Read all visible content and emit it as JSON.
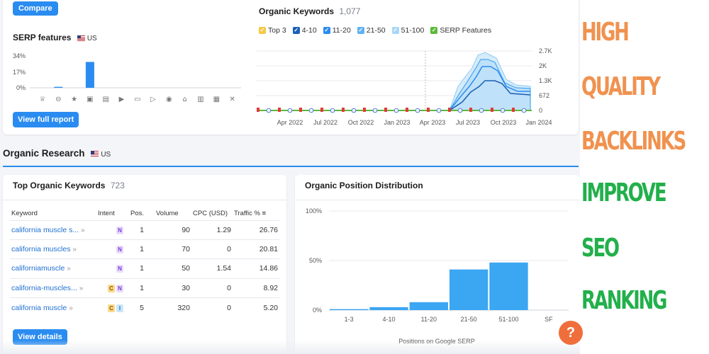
{
  "compare_label": "Compare",
  "serp": {
    "title": "SERP features",
    "country": "US",
    "y_ticks": [
      "34%",
      "17%",
      "0%"
    ],
    "icons": [
      "trophy-icon",
      "link-icon",
      "star-icon",
      "image-icon",
      "images-icon",
      "video-icon",
      "video-box-icon",
      "play-icon",
      "location-icon",
      "graduation-icon",
      "document-icon",
      "briefcase-icon",
      "x-icon"
    ],
    "bars": [
      0,
      1,
      0,
      27,
      0,
      0,
      0,
      0,
      0,
      0,
      0,
      0,
      0
    ],
    "view_full_report_label": "View full report"
  },
  "organic_keywords": {
    "title": "Organic Keywords",
    "count": "1,077",
    "legend": [
      {
        "label": "Top 3",
        "color": "#f7c844"
      },
      {
        "label": "4-10",
        "color": "#1c5fb8"
      },
      {
        "label": "11-20",
        "color": "#2a8cf0"
      },
      {
        "label": "21-50",
        "color": "#5fb1f2"
      },
      {
        "label": "51-100",
        "color": "#a9d6f7"
      },
      {
        "label": "SERP Features",
        "color": "#5cb93b"
      }
    ],
    "y_ticks": [
      "2.7K",
      "2K",
      "1.3K",
      "672",
      "0"
    ],
    "x_ticks": [
      "Apr 2022",
      "Jul 2022",
      "Oct 2022",
      "Jan 2023",
      "Apr 2023",
      "Jul 2023",
      "Oct 2023",
      "Jan 2024"
    ]
  },
  "organic_research": {
    "title": "Organic Research",
    "country": "US"
  },
  "top_keywords": {
    "title": "Top Organic Keywords",
    "count": "723",
    "columns": [
      "Keyword",
      "Intent",
      "Pos.",
      "Volume",
      "CPC (USD)",
      "Traffic %"
    ],
    "rows": [
      {
        "keyword": "california muscle s...",
        "intent": [
          "N"
        ],
        "pos": "1",
        "volume": "90",
        "cpc": "1.29",
        "traffic": "26.76"
      },
      {
        "keyword": "california muscles",
        "intent": [
          "N"
        ],
        "pos": "1",
        "volume": "70",
        "cpc": "0",
        "traffic": "20.81"
      },
      {
        "keyword": "californiamuscle",
        "intent": [
          "N"
        ],
        "pos": "1",
        "volume": "50",
        "cpc": "1.54",
        "traffic": "14.86"
      },
      {
        "keyword": "california-muscles...",
        "intent": [
          "C",
          "N"
        ],
        "pos": "1",
        "volume": "30",
        "cpc": "0",
        "traffic": "8.92"
      },
      {
        "keyword": "california muscle",
        "intent": [
          "C",
          "I"
        ],
        "pos": "5",
        "volume": "320",
        "cpc": "0",
        "traffic": "5.20"
      }
    ],
    "view_details_label": "View details"
  },
  "position_distribution": {
    "title": "Organic Position Distribution",
    "y_ticks": [
      "100%",
      "50%",
      "0%"
    ],
    "xlabel": "Positions on Google SERP"
  },
  "chart_data": [
    {
      "type": "bar",
      "title": "Organic Position Distribution",
      "xlabel": "Positions on Google SERP",
      "ylabel": "",
      "categories": [
        "1-3",
        "4-10",
        "11-20",
        "21-50",
        "51-100",
        "SF"
      ],
      "values": [
        1,
        3,
        8,
        41,
        48,
        0
      ],
      "ylim": [
        0,
        100
      ]
    }
  ],
  "headline": [
    {
      "text": "HIGH",
      "color": "#f0924f"
    },
    {
      "text": "QUALITY",
      "color": "#f0924f"
    },
    {
      "text": "BACKLINKS",
      "color": "#f0924f"
    },
    {
      "text": "IMPROVE",
      "color": "#22b04b"
    },
    {
      "text": "SEO",
      "color": "#22b04b"
    },
    {
      "text": "RANKING",
      "color": "#22b04b"
    }
  ],
  "help_label": "?"
}
